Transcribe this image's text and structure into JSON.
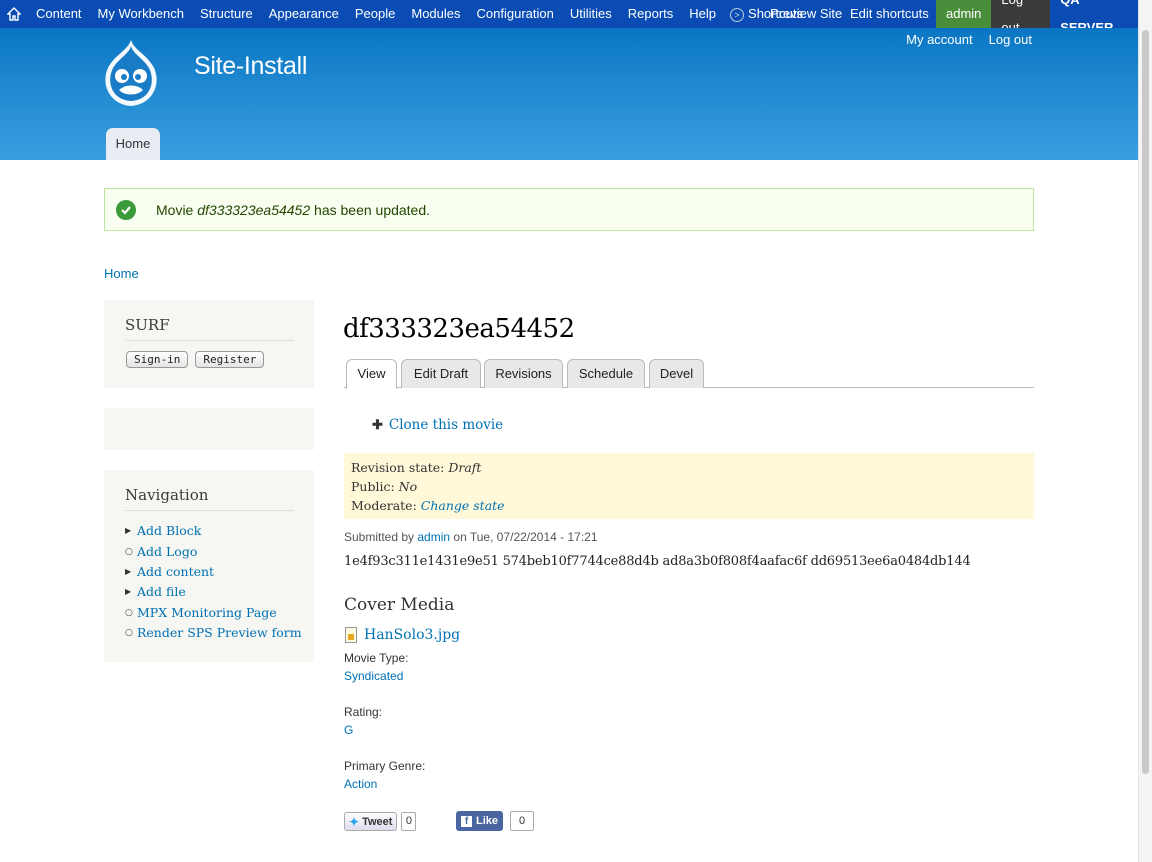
{
  "toolbar": {
    "items": [
      "Content",
      "My Workbench",
      "Structure",
      "Appearance",
      "People",
      "Modules",
      "Configuration",
      "Utilities",
      "Reports",
      "Help"
    ],
    "shortcuts": "Shortcuts",
    "preview_site": "Preview Site",
    "edit_shortcuts": "Edit shortcuts",
    "user": "admin",
    "logout": "Log out",
    "server": "QA SERVER"
  },
  "header": {
    "site_name": "Site-Install",
    "secondary_menu": [
      "My account",
      "Log out"
    ],
    "main_tab": "Home"
  },
  "message": {
    "prefix": "Movie ",
    "title": "df333323ea54452",
    "suffix": " has been updated."
  },
  "breadcrumb": "Home",
  "sidebar": {
    "surf_title": "SURF",
    "signin": "Sign-in",
    "register": "Register",
    "nav_title": "Navigation",
    "nav_items": [
      {
        "label": "Add Block",
        "bullet": "arrow"
      },
      {
        "label": "Add Logo",
        "bullet": "circle"
      },
      {
        "label": "Add content",
        "bullet": "arrow"
      },
      {
        "label": "Add file",
        "bullet": "arrow"
      },
      {
        "label": "MPX Monitoring Page",
        "bullet": "circle"
      },
      {
        "label": "Render SPS Preview form",
        "bullet": "circle"
      }
    ]
  },
  "main": {
    "title": "df333323ea54452",
    "tabs": [
      "View",
      "Edit Draft",
      "Revisions",
      "Schedule",
      "Devel"
    ],
    "active_tab": "View",
    "clone_link": "Clone this movie",
    "revision": {
      "state_label": "Revision state: ",
      "state_value": "Draft",
      "public_label": "Public: ",
      "public_value": "No",
      "moderate_label": "Moderate: ",
      "moderate_value": "Change state"
    },
    "submitted": {
      "prefix": "Submitted by ",
      "user": "admin",
      "suffix": " on Tue, 07/22/2014 - 17:21"
    },
    "hash": "1e4f93c311e1431e9e51 574beb10f7744ce88d4b ad8a3b0f808f4aafac6f dd69513ee6a0484db144",
    "cover_media_title": "Cover Media",
    "file_name": "HanSolo3.jpg",
    "fields": [
      {
        "label": "Movie Type:",
        "value": "Syndicated"
      },
      {
        "label": "Rating:",
        "value": "G"
      },
      {
        "label": "Primary Genre:",
        "value": "Action"
      }
    ],
    "tweet": {
      "label": "Tweet",
      "count": "0"
    },
    "like": {
      "label": "Like",
      "count": "0"
    }
  },
  "colors": {
    "toolbar_bg": "#0b4cb4",
    "link": "#0071b3",
    "message_bg": "#f8fff0",
    "revision_bg": "#fff9d9"
  }
}
